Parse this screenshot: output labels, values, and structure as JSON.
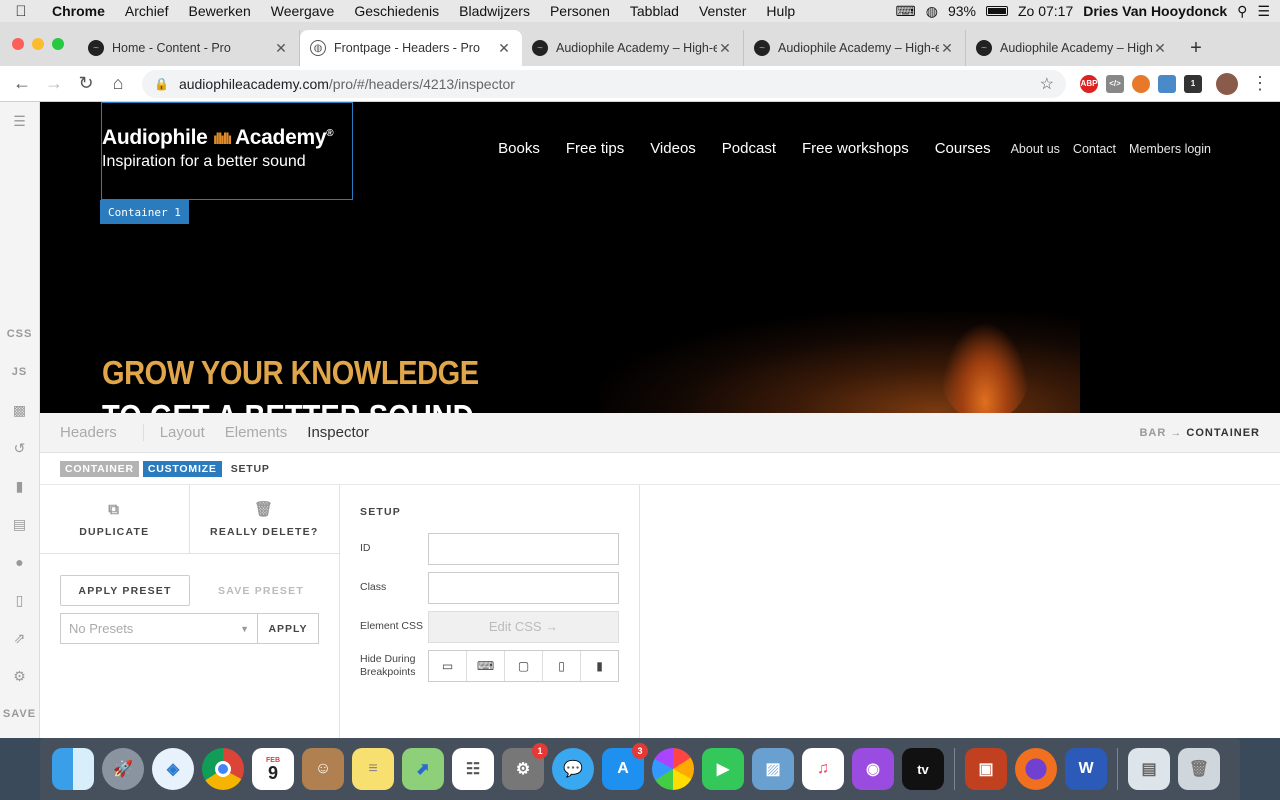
{
  "menubar": {
    "app": "Chrome",
    "items": [
      "Archief",
      "Bewerken",
      "Weergave",
      "Geschiedenis",
      "Bladwijzers",
      "Personen",
      "Tabblad",
      "Venster",
      "Hulp"
    ],
    "battery": "93%",
    "clock": "Zo 07:17",
    "user": "Dries Van Hooydonck"
  },
  "browser": {
    "tabs": [
      {
        "title": "Home - Content - Pro"
      },
      {
        "title": "Frontpage - Headers - Pro"
      },
      {
        "title": "Audiophile Academy – High-e"
      },
      {
        "title": "Audiophile Academy – High-e"
      },
      {
        "title": "Audiophile Academy – High-e"
      }
    ],
    "url_host": "audiophileacademy.com",
    "url_path": "/pro/#/headers/4213/inspector",
    "ext_abp": "ABP"
  },
  "leftbar": {
    "css": "CSS",
    "js": "JS",
    "save": "SAVE"
  },
  "site": {
    "logo_left": "Audiophile",
    "logo_right": "Academy",
    "logo_reg": "®",
    "tagline": "Inspiration for a better sound",
    "container_label": "Container 1",
    "nav_main": [
      "Books",
      "Free tips",
      "Videos",
      "Podcast",
      "Free workshops",
      "Courses"
    ],
    "nav_small": [
      "About us",
      "Contact",
      "Members login"
    ],
    "hero_line1": "GROW YOUR KNOWLEDGE",
    "hero_line2": "TO GET A BETTER SOUND"
  },
  "editor": {
    "tabs": {
      "headers": "Headers",
      "layout": "Layout",
      "elements": "Elements",
      "inspector": "Inspector"
    },
    "crumb_left": "BAR",
    "crumb_arrow": "→",
    "crumb_right": "CONTAINER",
    "breadcrumb": {
      "container": "CONTAINER",
      "customize": "CUSTOMIZE",
      "setup": "SETUP"
    },
    "duplicate": "DUPLICATE",
    "delete": "REALLY DELETE?",
    "apply_preset": "APPLY PRESET",
    "save_preset": "SAVE PRESET",
    "presets_value": "No Presets",
    "apply": "APPLY",
    "setup_title": "SETUP",
    "id_label": "ID",
    "class_label": "Class",
    "css_label": "Element CSS",
    "edit_css": "Edit CSS →",
    "hide_label": "Hide During Breakpoints"
  },
  "dock": {
    "calendar_month": "FEB",
    "calendar_day": "9",
    "tv": "tv",
    "settings_badge": "1",
    "appstore_badge": "3"
  }
}
